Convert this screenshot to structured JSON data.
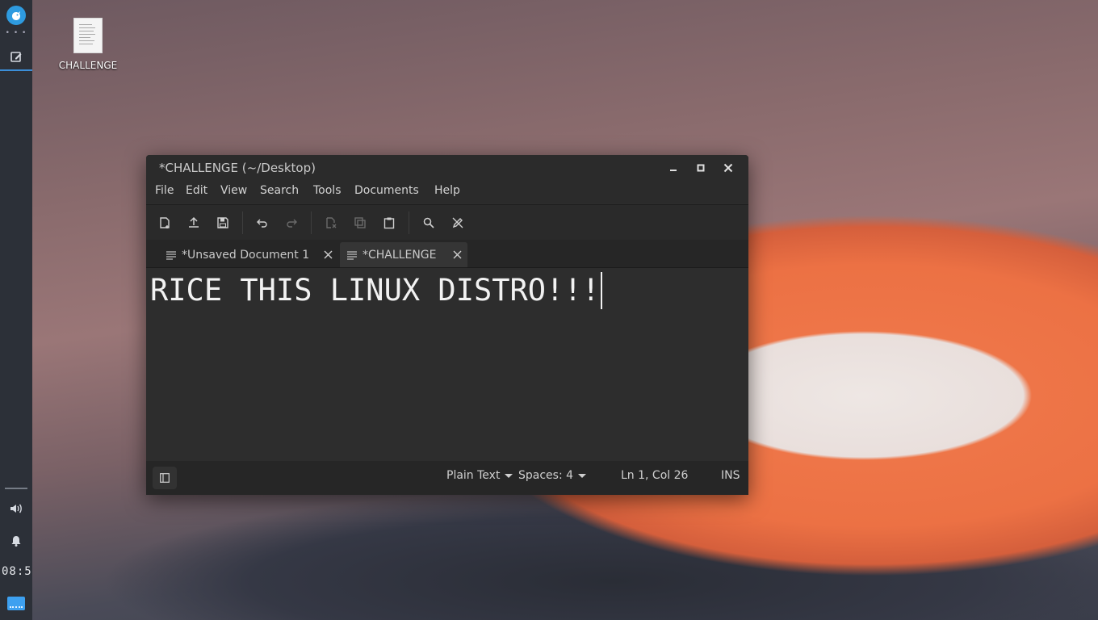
{
  "desktop": {
    "icon_label": "CHALLENGE"
  },
  "panel": {
    "clock": "08:5",
    "icons": [
      "app-menu-icon",
      "text-editor-task-icon",
      "volume-icon",
      "notification-bell-icon",
      "show-desktop-icon"
    ],
    "accent": "#3b8ed8"
  },
  "window": {
    "title": "*CHALLENGE (~/Desktop)",
    "menu": {
      "file": "File",
      "edit": "Edit",
      "view": "View",
      "search": "Search",
      "tools": "Tools",
      "documents": "Documents",
      "help": "Help"
    },
    "toolbar_icons": [
      "new-document-icon",
      "open-icon",
      "save-icon",
      "undo-icon",
      "redo-icon",
      "cut-icon",
      "copy-icon",
      "paste-icon",
      "find-icon",
      "find-replace-icon"
    ],
    "tabs": [
      {
        "label": "*Unsaved Document 1",
        "active": false
      },
      {
        "label": "*CHALLENGE",
        "active": true
      }
    ],
    "content": "RICE THIS LINUX DISTRO!!!",
    "status": {
      "language": "Plain Text",
      "spaces": "Spaces: 4",
      "position": "Ln 1, Col 26",
      "mode": "INS"
    }
  }
}
